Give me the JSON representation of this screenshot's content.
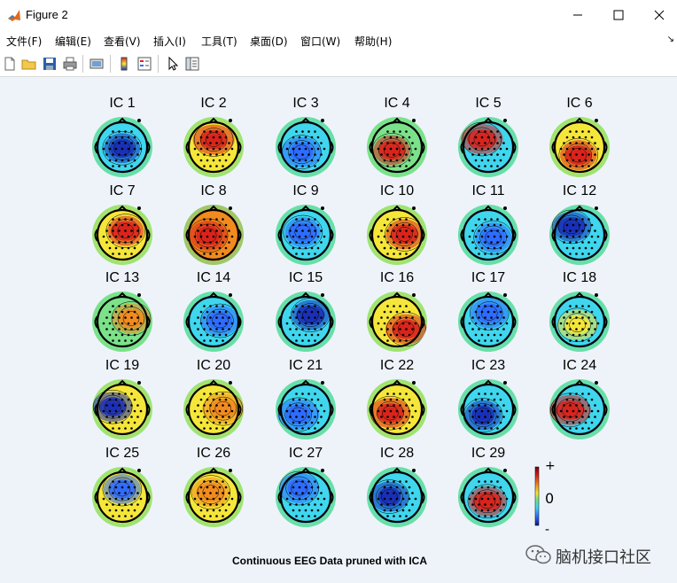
{
  "window": {
    "title": "Figure 2"
  },
  "menu": [
    "文件(F)",
    "编辑(E)",
    "查看(V)",
    "插入(I)",
    "工具(T)",
    "桌面(D)",
    "窗口(W)",
    "帮助(H)"
  ],
  "toolbar_icons": [
    "new-figure-icon",
    "open-file-icon",
    "save-icon",
    "print-icon",
    "print-preview-icon",
    "insert-colorbar-icon",
    "insert-legend-icon",
    "pointer-icon",
    "property-editor-icon"
  ],
  "figure": {
    "title": "Continuous EEG Data pruned with ICA",
    "components": [
      "IC 1",
      "IC 2",
      "IC 3",
      "IC 4",
      "IC 5",
      "IC 6",
      "IC 7",
      "IC 8",
      "IC 9",
      "IC 10",
      "IC 11",
      "IC 12",
      "IC 13",
      "IC 14",
      "IC 15",
      "IC 16",
      "IC 17",
      "IC 18",
      "IC 19",
      "IC 20",
      "IC 21",
      "IC 22",
      "IC 23",
      "IC 24",
      "IC 25",
      "IC 26",
      "IC 27",
      "IC 28",
      "IC 29"
    ],
    "colorbar": {
      "max_label": "+",
      "mid_label": "0",
      "min_label": "-"
    }
  },
  "colors": {
    "deep_blue": "#1a2fb8",
    "blue": "#2e6bff",
    "cyan": "#3fd6ee",
    "green": "#7be28a",
    "yellow": "#f5e63a",
    "orange": "#f28a1e",
    "red": "#d9231c"
  },
  "watermark": {
    "text": "脑机接口社区"
  }
}
